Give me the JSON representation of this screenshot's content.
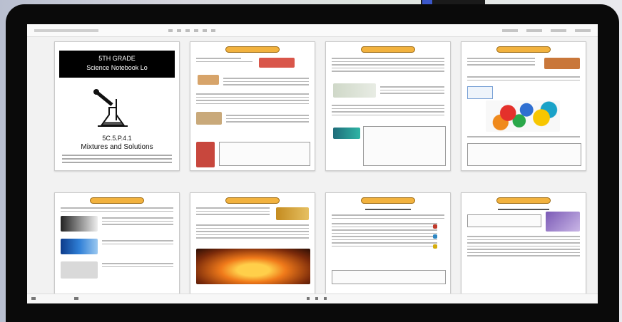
{
  "cover": {
    "title_line1": "5TH GRADE",
    "title_line2": "Science Notebook Lo",
    "standard": "5C.5.P.4.1",
    "subtitle": "Mixtures and Solutions"
  },
  "colors": {
    "badge": "#f2b23e",
    "device": "#0a0a0a",
    "screen": "#f2f2f2"
  },
  "icons": [
    "flask-icon"
  ]
}
